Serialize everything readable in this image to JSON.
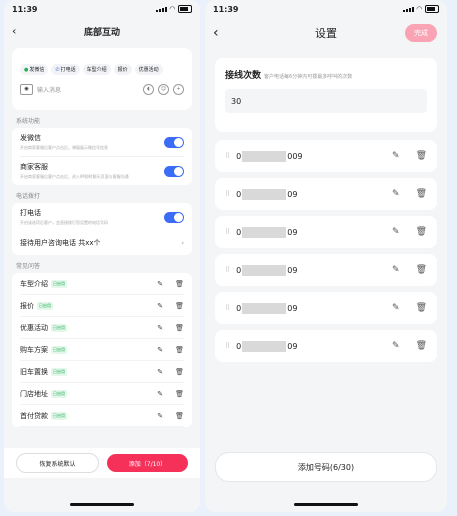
{
  "left": {
    "status": {
      "time": "11:39"
    },
    "nav": {
      "back": "‹",
      "title": "底部互动"
    },
    "preview": {
      "chips": [
        {
          "icon": "●",
          "label": "发微信",
          "color": "green"
        },
        {
          "icon": "✆",
          "label": "打电话",
          "color": "blue"
        },
        {
          "icon": "",
          "label": "车型介绍",
          "color": ""
        },
        {
          "icon": "",
          "label": "报价",
          "color": ""
        },
        {
          "icon": "",
          "label": "优惠活动",
          "color": ""
        }
      ],
      "input_placeholder": "输入消息"
    },
    "system_section": "系统功能",
    "system_items": [
      {
        "title": "发微信",
        "desc": "开启商家客服后客户点击后，弹窗展示微信号信息"
      },
      {
        "title": "商家客服",
        "desc": "开启商家客服后客户点击后，进入IM即时聊天页面与客服沟通"
      }
    ],
    "phone_section": "电话拨打",
    "phone_items": [
      {
        "title": "打电话",
        "desc": "开启该选项后客户，会直接拨打您设置的电话号码"
      }
    ],
    "phone_link": "接待用户咨询电话 共xx个",
    "qa_section": "常见问答",
    "qa_items": [
      {
        "name": "车型介绍",
        "tag": "已启用"
      },
      {
        "name": "报价",
        "tag": "已启用"
      },
      {
        "name": "优惠活动",
        "tag": "已启用"
      },
      {
        "name": "购车方案",
        "tag": "已启用"
      },
      {
        "name": "旧车置换",
        "tag": "已启用"
      },
      {
        "name": "门店地址",
        "tag": "已启用"
      },
      {
        "name": "首付贷款",
        "tag": "已启用"
      }
    ],
    "buttons": {
      "reset": "恢复系统默认",
      "add": "添加（7/10）"
    }
  },
  "right": {
    "status": {
      "time": "11:39"
    },
    "nav": {
      "back": "‹",
      "title": "设置",
      "done": "完成"
    },
    "count": {
      "title": "接线次数",
      "desc": "客户电话每6分钟内可拨最多呼叫的次数",
      "value": "30"
    },
    "numbers": [
      {
        "prefix": "0",
        "suffix": "009"
      },
      {
        "prefix": "0",
        "suffix": "09"
      },
      {
        "prefix": "0",
        "suffix": "09"
      },
      {
        "prefix": "0",
        "suffix": "09"
      },
      {
        "prefix": "0",
        "suffix": "09"
      },
      {
        "prefix": "0",
        "suffix": "09"
      }
    ],
    "add_button": "添加号码(6/30)"
  },
  "colors": {
    "accent": "#3b6cf6",
    "add_button": "#f5315a",
    "done_button": "#f9a3b5",
    "tag_green": "#20b05a"
  },
  "icons": {
    "edit": "edit-icon",
    "delete": "trash-icon",
    "drag": "drag-handle-icon"
  }
}
